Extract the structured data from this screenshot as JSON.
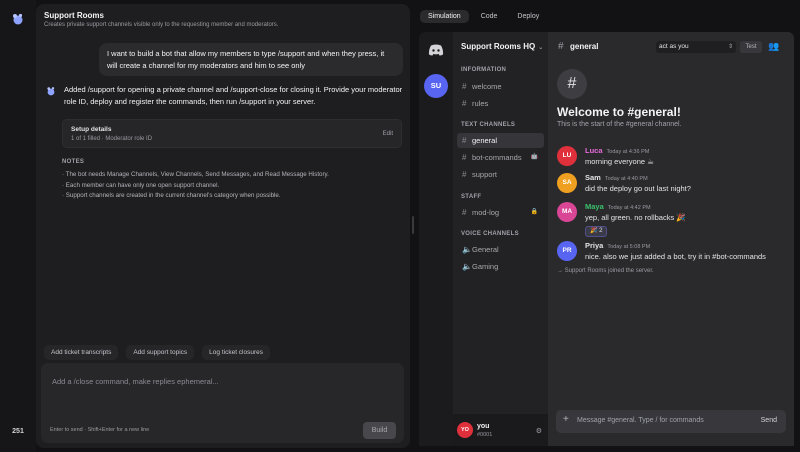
{
  "rail": {
    "credits": "251"
  },
  "chat": {
    "title": "Support Rooms",
    "subtitle": "Creates private support channels visible only to the requesting member and moderators.",
    "user_message": "I want to build a bot that allow my members to type /support and when they press, it will create a channel for my moderators and him to see only",
    "bot_message": "Added /support for opening a private channel and /support-close for closing it. Provide your moderator role ID, deploy and register the commands, then run /support in your server.",
    "setup": {
      "title": "Setup details",
      "status": "1 of 1 filled · Moderator role ID",
      "edit_label": "Edit"
    },
    "notes_heading": "NOTES",
    "notes": [
      "· The bot needs Manage Channels, View Channels, Send Messages, and Read Message History.",
      "· Each member can have only one open support channel.",
      "· Support channels are created in the current channel's category when possible."
    ],
    "suggestions": [
      "Add ticket transcripts",
      "Add support topics",
      "Log ticket closures"
    ],
    "composer": {
      "placeholder": "Add a /close command, make replies ephemeral...",
      "hint": "Enter to send · Shift+Enter for a new line",
      "build_label": "Build"
    }
  },
  "tabs": [
    {
      "label": "Simulation",
      "active": true
    },
    {
      "label": "Code",
      "active": false
    },
    {
      "label": "Deploy",
      "active": false
    }
  ],
  "servers": {
    "current_initials": "SU"
  },
  "server": {
    "name": "Support Rooms HQ",
    "categories": {
      "information": "INFORMATION",
      "text": "TEXT CHANNELS",
      "staff": "STAFF",
      "voice": "VOICE CHANNELS"
    },
    "information_channels": [
      "welcome",
      "rules"
    ],
    "text_channels": [
      "general",
      "bot-commands",
      "support"
    ],
    "text_channel_badge": "🤖",
    "staff_channels": [
      "mod-log"
    ],
    "staff_lock": "🔒",
    "voice_channels": [
      "General",
      "Gaming"
    ],
    "user": {
      "initials": "YO",
      "name": "you",
      "discriminator": "#0001"
    }
  },
  "channel": {
    "name": "general",
    "act_as": "act as you",
    "test_label": "Test",
    "welcome_title": "Welcome to #general!",
    "welcome_sub": "This is the start of the #general channel.",
    "messages": [
      {
        "initials": "LU",
        "author": "Luca",
        "time": "Today at 4:36 PM",
        "text": "morning everyone ☕",
        "avatar_color": "#e0303b",
        "name_color": "#e86bd9"
      },
      {
        "initials": "SA",
        "author": "Sam",
        "time": "Today at 4:40 PM",
        "text": "did the deploy go out last night?",
        "avatar_color": "#f0a020",
        "name_color": "#e4e4e7"
      },
      {
        "initials": "MA",
        "author": "Maya",
        "time": "Today at 4:42 PM",
        "text": "yep, all green. no rollbacks 🎉",
        "avatar_color": "#d94695",
        "name_color": "#3ac26b",
        "reaction": "🎉 2"
      },
      {
        "initials": "PR",
        "author": "Priya",
        "time": "Today at 5:08 PM",
        "text": "nice. also we just added a bot, try it in #bot-commands",
        "avatar_color": "#5865f2",
        "name_color": "#e4e4e7"
      }
    ],
    "join_notice": "→ Support Rooms joined the server.",
    "input_placeholder": "Message #general. Type / for commands",
    "send_label": "Send"
  }
}
